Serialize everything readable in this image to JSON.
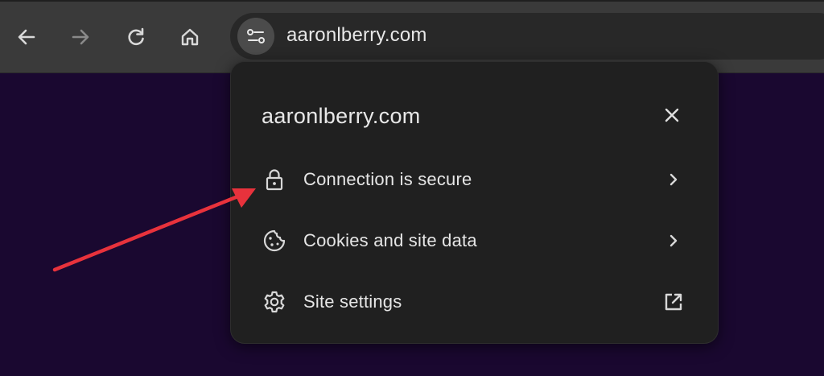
{
  "browser": {
    "url": "aaronlberry.com",
    "nav": {
      "back": "back-arrow-icon",
      "forward": "forward-arrow-icon",
      "reload": "reload-icon",
      "home": "home-icon",
      "site_info": "tune-icon"
    }
  },
  "popup": {
    "title": "aaronlberry.com",
    "close_icon": "close-icon",
    "items": [
      {
        "label": "Connection is secure",
        "icon": "lock-icon",
        "trail": "chevron-right-icon"
      },
      {
        "label": "Cookies and site data",
        "icon": "cookie-icon",
        "trail": "chevron-right-icon"
      },
      {
        "label": "Site settings",
        "icon": "gear-icon",
        "trail": "open-external-icon"
      }
    ]
  },
  "colors": {
    "page_background": "#1a0830",
    "toolbar": "#3a3a3a",
    "popup_background": "#202020",
    "annotation_arrow": "#e8323c"
  }
}
